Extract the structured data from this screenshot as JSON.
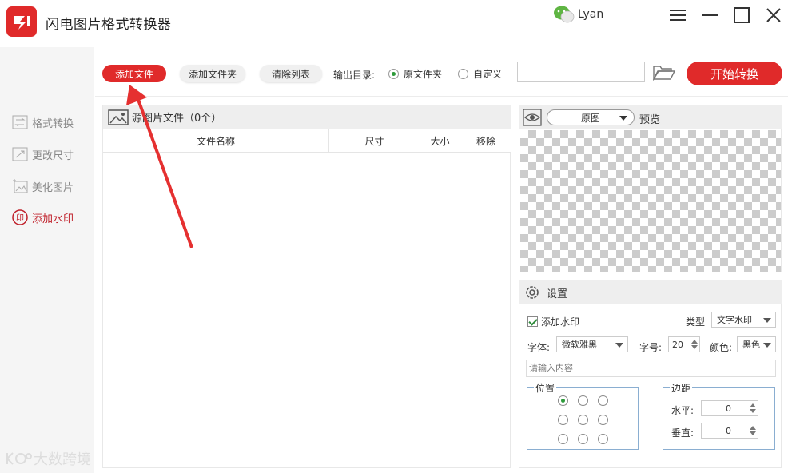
{
  "app": {
    "title": "闪电图片格式转换器",
    "user_name": "Lyan",
    "accent_color": "#e02a2a"
  },
  "window": {
    "menu_icon": "hamburger-icon",
    "minimize_icon": "minimize-icon",
    "maximize_icon": "maximize-icon",
    "close_icon": "close-icon"
  },
  "sidebar": {
    "items": [
      {
        "label": "格式转换",
        "icon": "format-convert-icon",
        "active": false
      },
      {
        "label": "更改尺寸",
        "icon": "resize-icon",
        "active": false
      },
      {
        "label": "美化图片",
        "icon": "beautify-icon",
        "active": false
      },
      {
        "label": "添加水印",
        "icon": "watermark-icon",
        "active": true
      }
    ],
    "watermark_text": "大数跨境"
  },
  "toolbar": {
    "add_file": "添加文件",
    "add_folder": "添加文件夹",
    "clear_list": "清除列表",
    "output_label": "输出目录:",
    "radio_original": "原文件夹",
    "radio_custom": "自定义",
    "path_value": "",
    "start": "开始转换"
  },
  "file_list": {
    "header": "源图片文件（0个）",
    "columns": [
      "文件名称",
      "尺寸",
      "大小",
      "移除"
    ],
    "rows": []
  },
  "preview": {
    "select_value": "原图",
    "label": "预览"
  },
  "settings": {
    "title": "设置",
    "add_watermark": "添加水印",
    "type_label": "类型",
    "type_value": "文字水印",
    "font_label": "字体:",
    "font_value": "微软雅黑",
    "size_label": "字号:",
    "size_value": "20",
    "color_label": "颜色:",
    "color_value": "黑色",
    "content_placeholder": "请输入内容",
    "position_title": "位置",
    "margin_title": "边距",
    "horizontal_label": "水平:",
    "horizontal_value": "0",
    "vertical_label": "垂直:",
    "vertical_value": "0"
  }
}
